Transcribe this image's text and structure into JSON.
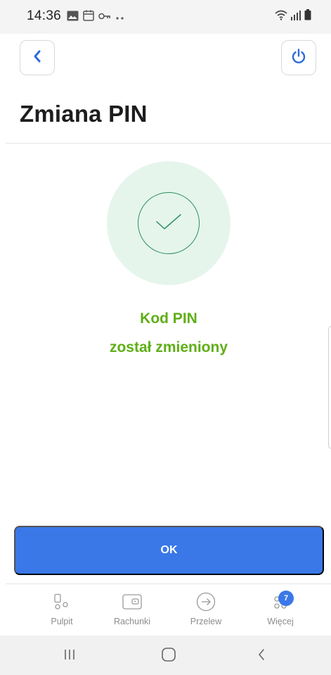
{
  "status_bar": {
    "time": "14:36",
    "left_icons": [
      "image-icon",
      "calendar-icon",
      "key-icon",
      "more-dots-icon"
    ],
    "right_icons": [
      "wifi-icon",
      "signal-icon",
      "battery-icon"
    ]
  },
  "header": {
    "back_icon": "chevron-left-icon",
    "power_icon": "power-icon",
    "title": "Zmiana PIN"
  },
  "success": {
    "icon": "check-icon",
    "line1": "Kod PIN",
    "line2": "został zmieniony"
  },
  "ok_button": {
    "label": "OK"
  },
  "tabbar": {
    "tabs": [
      {
        "label": "Pulpit",
        "icon": "dashboard-icon"
      },
      {
        "label": "Rachunki",
        "icon": "wallet-icon"
      },
      {
        "label": "Przelew",
        "icon": "transfer-arrow-icon"
      },
      {
        "label": "Więcej",
        "icon": "more-icon"
      }
    ],
    "badge_count": "7"
  },
  "system_nav": [
    "recents-icon",
    "home-icon",
    "back-icon"
  ],
  "colors": {
    "accent": "#3a78e8",
    "success_text": "#5fae17",
    "success_ring": "#2f8e60",
    "success_bg": "#e5f5ec"
  }
}
